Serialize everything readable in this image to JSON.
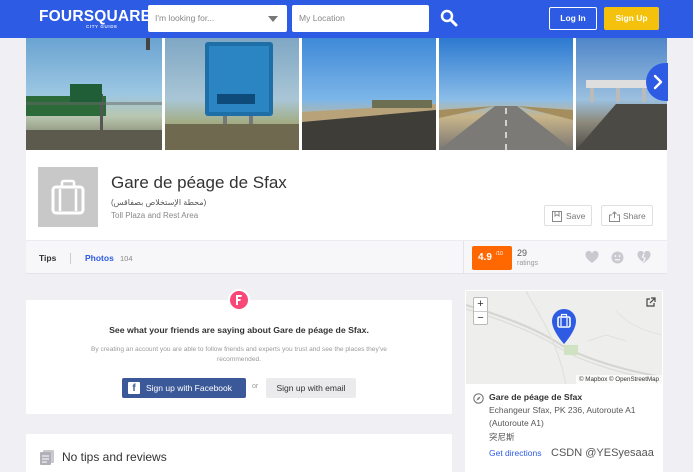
{
  "header": {
    "logo": "FOURSQUARE",
    "logo_sub": "CITY GUIDE",
    "search_placeholder": "I'm looking for...",
    "location_placeholder": "My Location",
    "login_label": "Log In",
    "signup_label": "Sign Up"
  },
  "photos": {
    "count": 5
  },
  "venue": {
    "name": "Gare de péage de Sfax",
    "arabic_name": "(محطة الإستخلاص بصفاقس)",
    "category": "Toll Plaza and Rest Area",
    "save_label": "Save",
    "share_label": "Share"
  },
  "tabs": {
    "tips_label": "Tips",
    "photos_label": "Photos",
    "photos_count": "104"
  },
  "rating": {
    "value": "4.9",
    "max": "/10",
    "count": "29",
    "count_label": "ratings"
  },
  "signup_prompt": {
    "heading": "See what your friends are saying about Gare de péage de Sfax.",
    "description": "By creating an account you are able to follow friends and experts you trust and see the places they've recommended.",
    "facebook_label": "Sign up with Facebook",
    "or_label": "or",
    "email_label": "Sign up with email"
  },
  "tips_section": {
    "title": "No tips and reviews"
  },
  "map": {
    "zoom_in": "+",
    "zoom_out": "−",
    "attribution": "© Mapbox © OpenStreetMap"
  },
  "address": {
    "name": "Gare de péage de Sfax",
    "line1": "Echangeur Sfax, PK 236, Autoroute A1",
    "line2": "(Autoroute A1)",
    "line3": "突尼斯",
    "directions_label": "Get directions"
  },
  "watermark": "CSDN @YESyesaaa",
  "colors": {
    "brand_blue": "#2d5be3",
    "signup_yellow": "#f4c20d",
    "rating_orange": "#ff6701",
    "facebook_blue": "#3b5998",
    "badge_pink": "#f94877"
  }
}
